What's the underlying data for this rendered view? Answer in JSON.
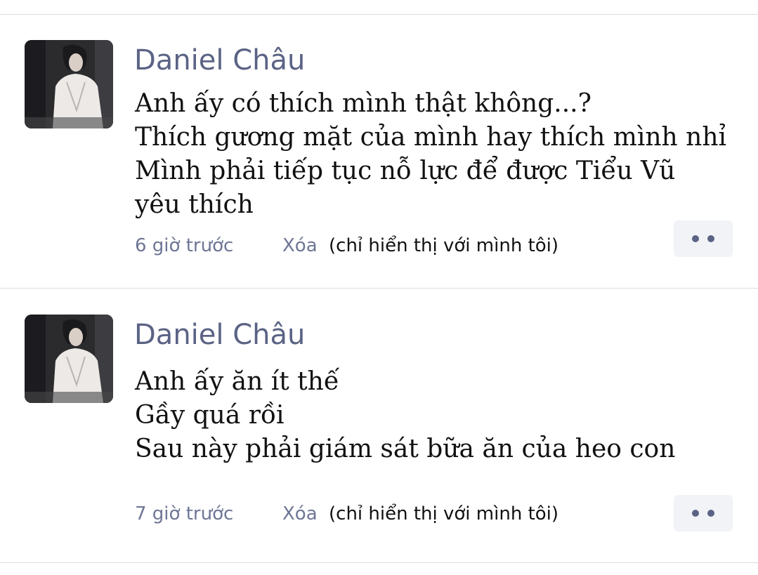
{
  "comments": [
    {
      "author": "Daniel Châu",
      "lines": [
        "Anh ấy có thích mình thật không...?",
        "Thích gương mặt của mình hay thích mình nhỉ",
        "Mình phải tiếp tục nỗ lực để được Tiểu Vũ",
        "yêu thích"
      ],
      "time": "6 giờ trước",
      "delete_label": "Xóa",
      "visibility_note": "(chỉ hiển thị với mình tôi)"
    },
    {
      "author": "Daniel Châu",
      "lines": [
        "Anh ấy ăn ít thế",
        "Gầy quá rồi",
        "Sau này phải giám sát bữa ăn của heo con"
      ],
      "time": "7 giờ trước",
      "delete_label": "Xóa",
      "visibility_note": "(chỉ hiển thị với mình tôi)"
    }
  ],
  "colors": {
    "author": "#5b6385",
    "meta": "#6e7695",
    "text": "#111111",
    "more_button_bg": "#f1f3f6",
    "divider": "#dcdcdc"
  },
  "icons": {
    "more": "more-dots-icon"
  }
}
